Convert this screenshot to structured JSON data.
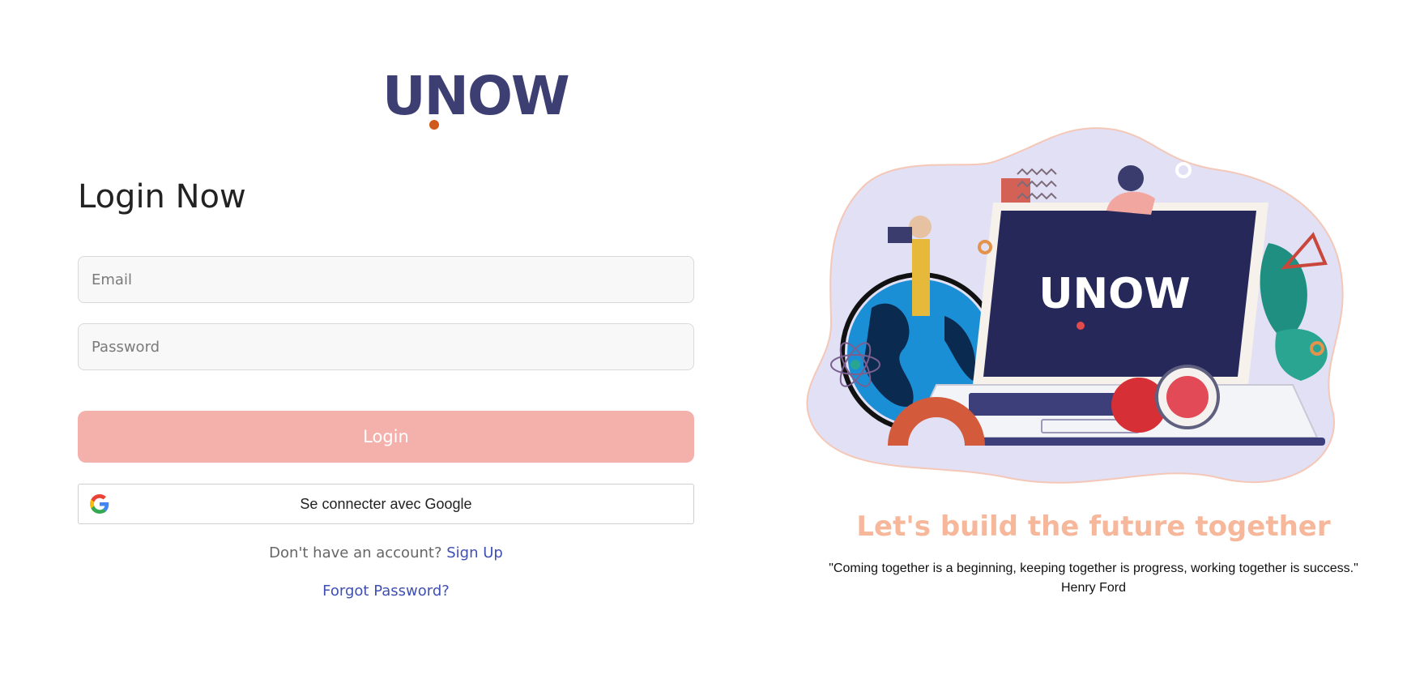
{
  "brand": {
    "logo_text": "UNOW"
  },
  "login": {
    "title": "Login Now",
    "email_placeholder": "Email",
    "password_placeholder": "Password",
    "login_label": "Login",
    "google_label": "Se connecter avec Google",
    "no_account_text": "Don't have an account?",
    "signup_link": "Sign Up",
    "forgot_link": "Forgot Password?"
  },
  "hero": {
    "headline": "Let's build the future together",
    "quote": "\"Coming together is a beginning, keeping together is progress, working together is success.\"",
    "quote_author": "Henry Ford"
  }
}
